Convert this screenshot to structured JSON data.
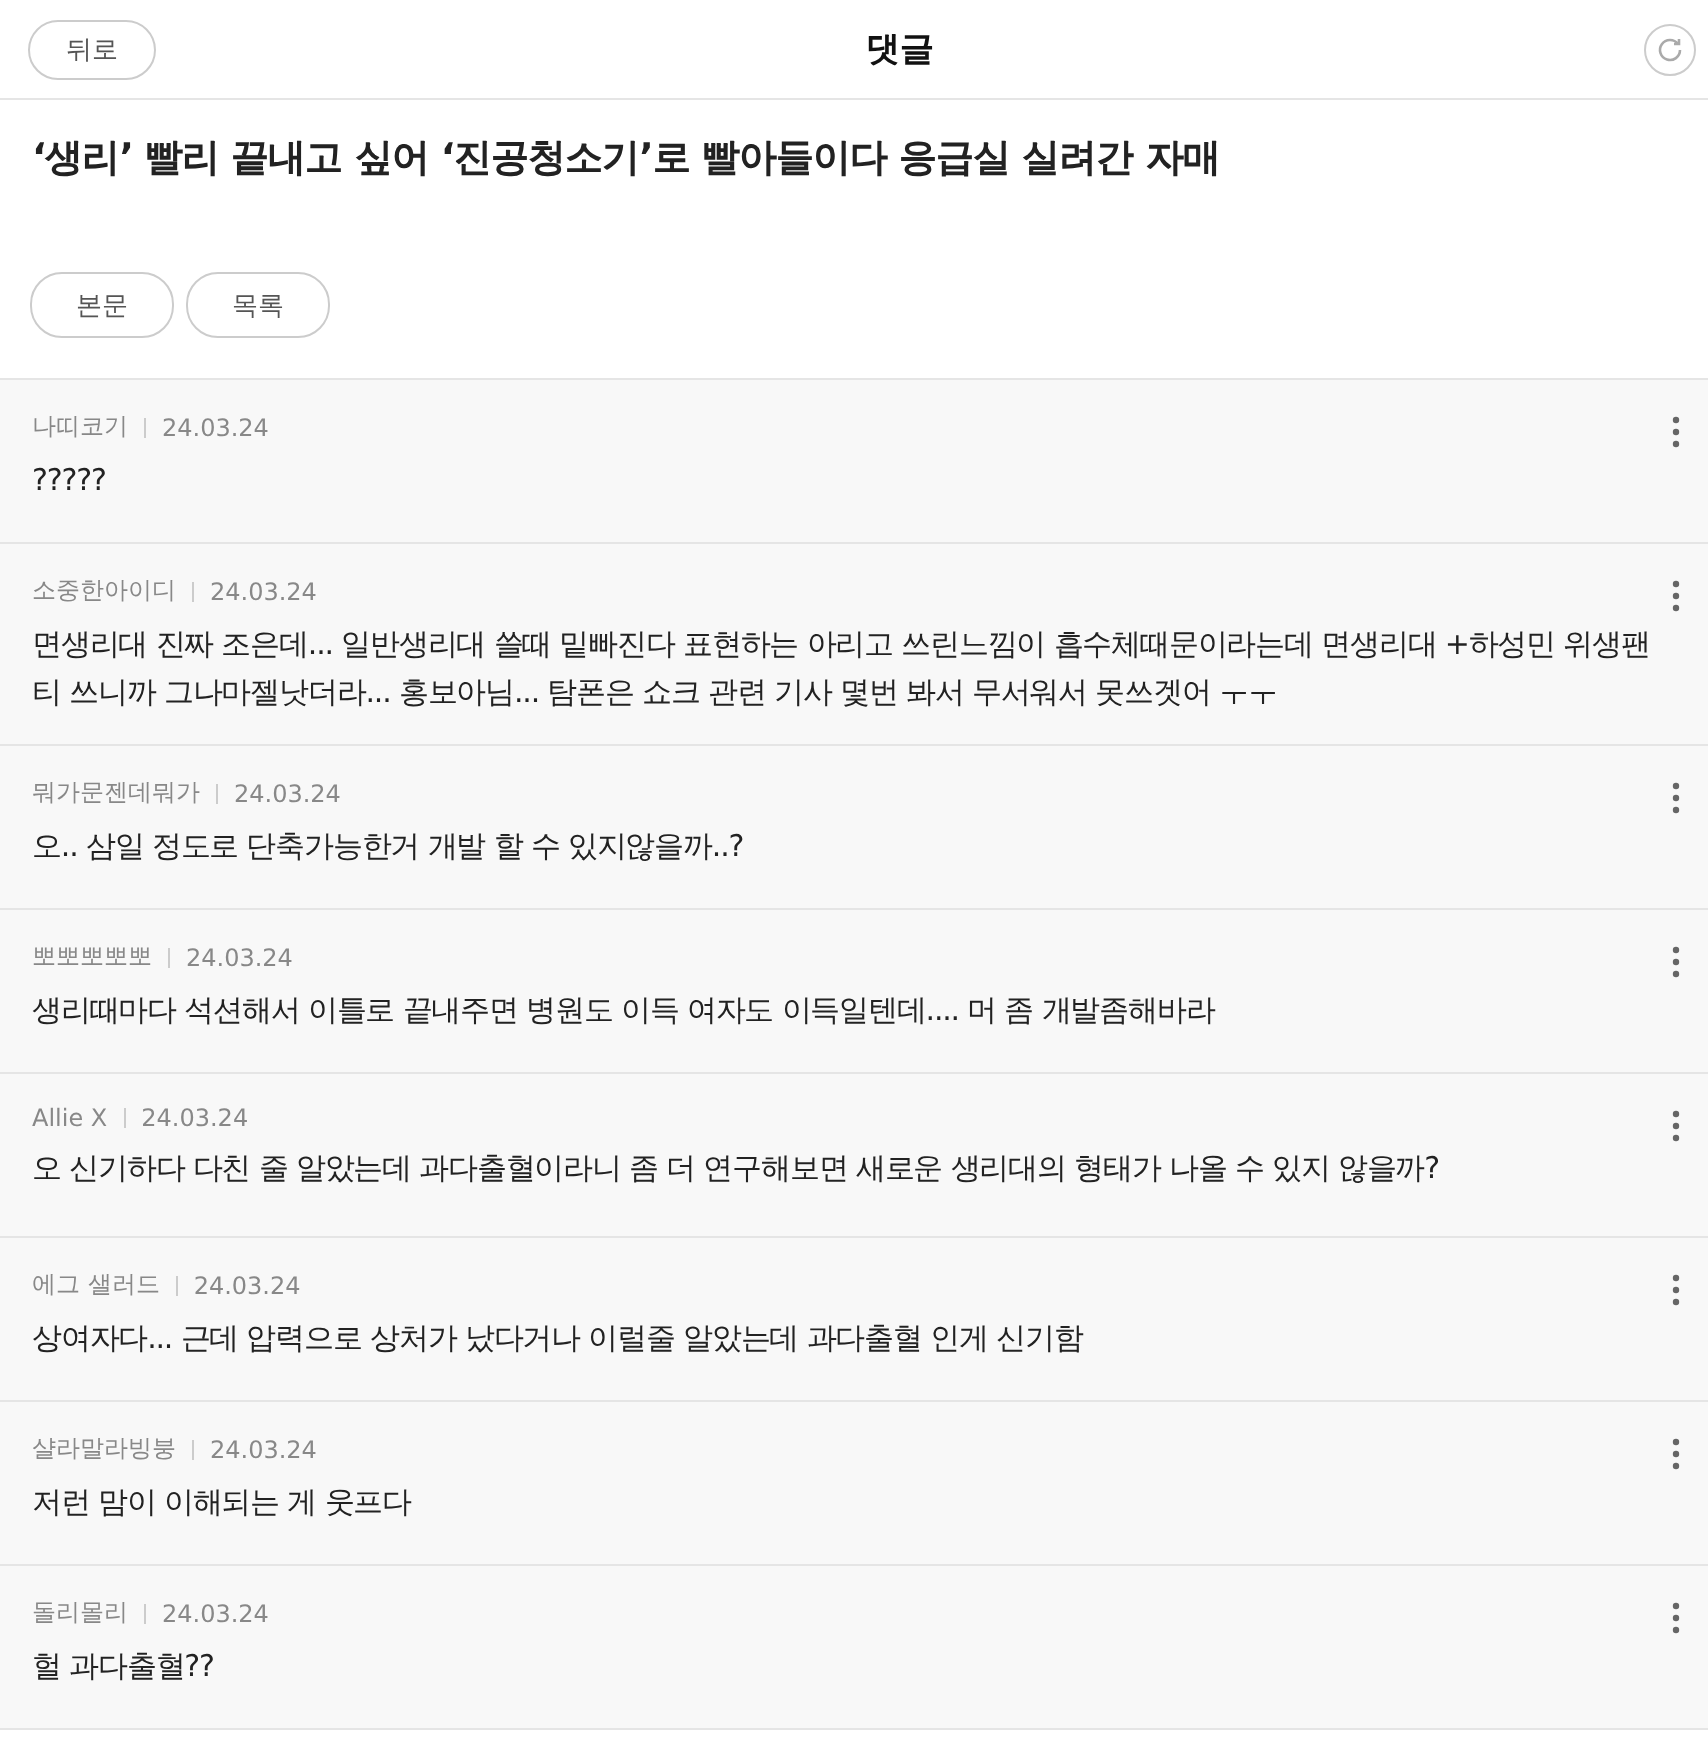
{
  "header": {
    "back": "뒤로",
    "title": "댓글"
  },
  "article": {
    "title": "‘생리’ 빨리 끝내고 싶어 ‘진공청소기’로 빨아들이다 응급실 실려간 자매",
    "buttons": [
      "본문",
      "목록"
    ]
  },
  "comments": [
    {
      "author": "나띠코기",
      "date": "24.03.24",
      "text": "?????"
    },
    {
      "author": "소중한아이디",
      "date": "24.03.24",
      "text": "면생리대 진짜 조은데... 일반생리대 쓸때 밑빠진다 표현하는 아리고 쓰린느낌이 흡수체때문이라는데 면생리대 +하성민 위생팬티 쓰니까 그나마젤낫더라... 홍보아님... 탐폰은 쇼크 관련 기사 몇번 봐서 무서워서 못쓰겟어 ㅜㅜ"
    },
    {
      "author": "뭐가문젠데뭐가",
      "date": "24.03.24",
      "text": "오.. 삼일 정도로 단축가능한거 개발 할 수 있지않을까..?"
    },
    {
      "author": "뽀뽀뽀뽀뽀",
      "date": "24.03.24",
      "text": "생리때마다 석션해서 이틀로 끝내주면 병원도 이득 여자도 이득일텐데.... 머 좀 개발좀해바라"
    },
    {
      "author": "Allie X",
      "date": "24.03.24",
      "text": "오 신기하다 다친 줄 알았는데 과다출혈이라니 좀 더 연구해보면 새로운 생리대의 형태가 나올 수 있지 않을까?"
    },
    {
      "author": "에그 샐러드",
      "date": "24.03.24",
      "text": "상여자다... 근데 압력으로 상처가 났다거나 이럴줄 알았는데 과다출혈 인게 신기함"
    },
    {
      "author": "샬라말라빙붕",
      "date": "24.03.24",
      "text": "저런 맘이 이해되는 게 웃프다"
    },
    {
      "author": "돌리몰리",
      "date": "24.03.24",
      "text": "헐 과다출혈??"
    }
  ]
}
